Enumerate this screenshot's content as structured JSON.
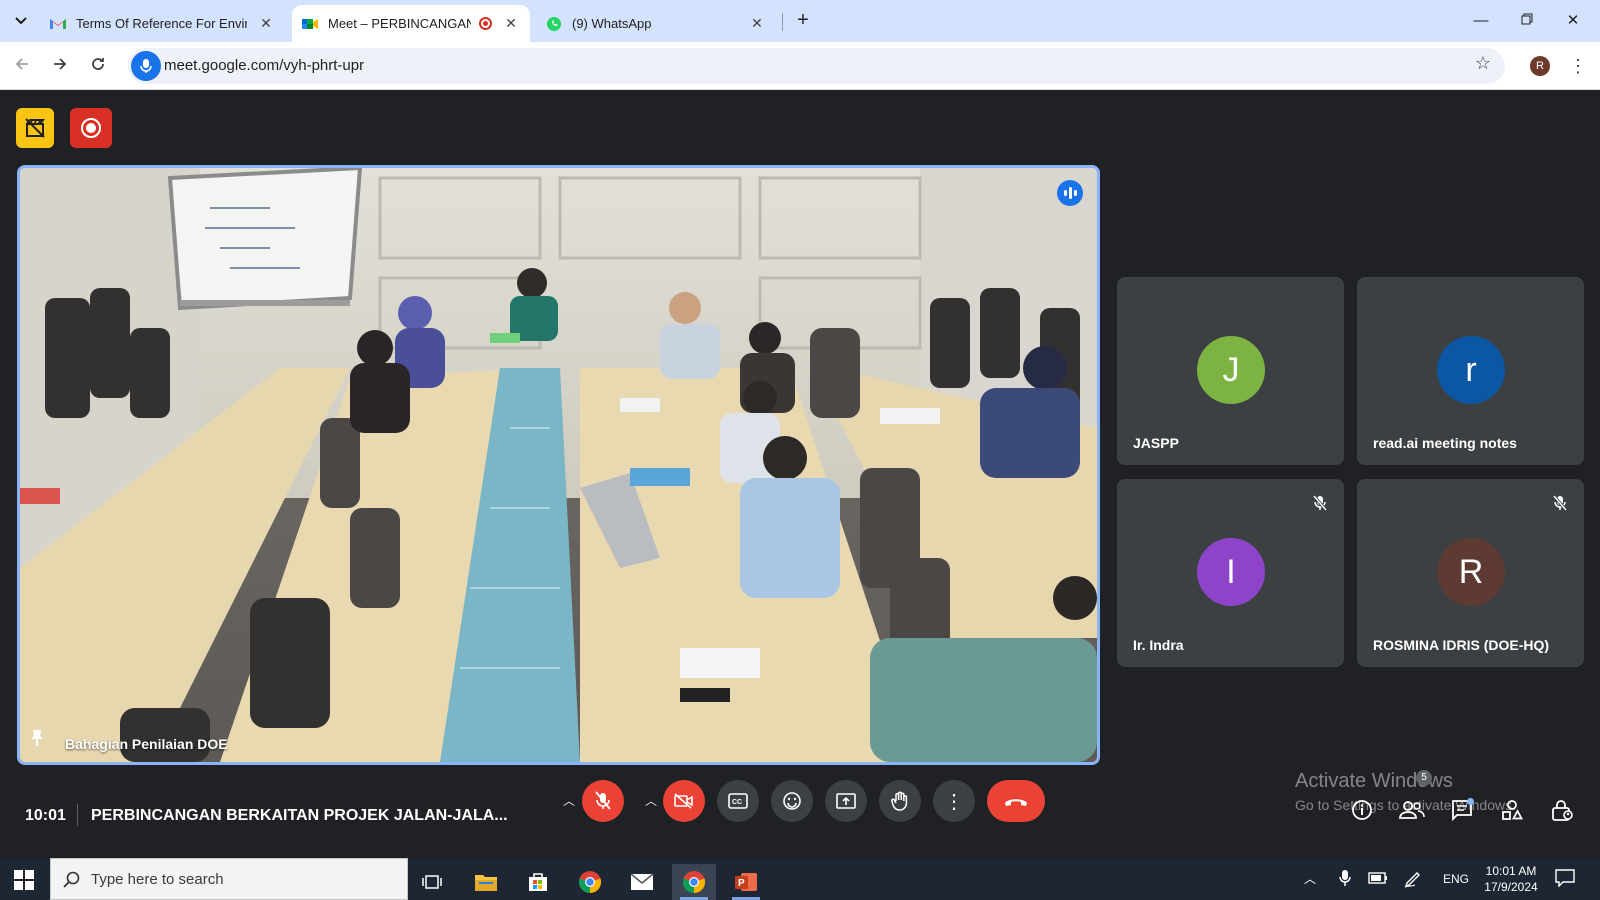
{
  "browser": {
    "tabs": [
      {
        "title": "Terms Of Reference For Environ",
        "favicon": "gmail-icon"
      },
      {
        "title": "Meet – PERBINCANGAN BE",
        "favicon": "meet-icon",
        "active": true,
        "recording": true
      },
      {
        "title": "(9) WhatsApp",
        "favicon": "whatsapp-icon"
      }
    ],
    "url": "meet.google.com/vyh-phrt-upr",
    "profile_initial": "R"
  },
  "meet": {
    "main_participant": "Bahagian Penilaian DOE",
    "participants": [
      {
        "name": "JASPP",
        "initial": "J",
        "color": "#7cb342",
        "muted": false
      },
      {
        "name": "read.ai meeting notes",
        "initial": "r",
        "color": "#0b57a4",
        "muted": false
      },
      {
        "name": "Ir. Indra",
        "initial": "I",
        "color": "#8e44c9",
        "muted": true
      },
      {
        "name": "ROSMINA IDRIS (DOE-HQ)",
        "initial": "R",
        "color": "#5d3b33",
        "muted": true
      }
    ],
    "time": "10:01",
    "title": "PERBINCANGAN BERKAITAN PROJEK JALAN-JALA...",
    "people_count": "5",
    "accent": "#8ab4f8",
    "danger": "#ea4335"
  },
  "watermark": {
    "line1": "Activate Windows",
    "line2": "Go to Settings to activate Windows."
  },
  "taskbar": {
    "search_placeholder": "Type here to search",
    "lang": "ENG",
    "time": "10:01 AM",
    "date": "17/9/2024"
  }
}
